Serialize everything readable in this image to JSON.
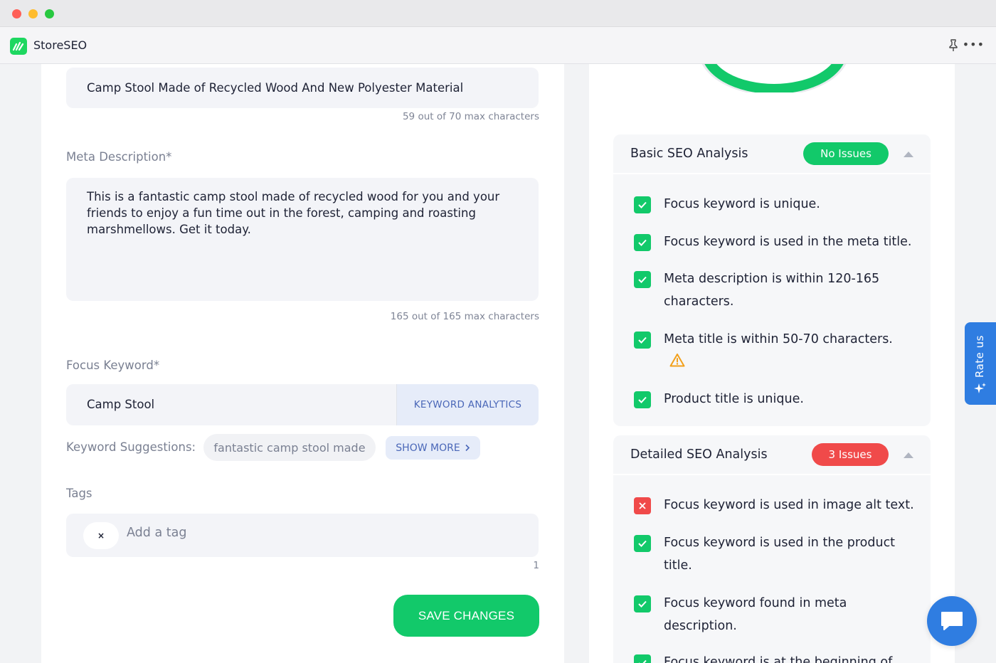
{
  "app": {
    "title": "StoreSEO",
    "accent": "#12c96a",
    "brand_blue": "#2f7de1"
  },
  "meta_title": {
    "value": "Camp Stool Made of Recycled Wood And New Polyester Material",
    "counter": "59 out of 70 max characters"
  },
  "meta_description": {
    "label": "Meta Description*",
    "value": "This is a fantastic camp stool made of recycled wood for you and your friends to enjoy a fun time out in the forest, camping and roasting marshmellows. Get it today.",
    "counter": "165 out of 165 max characters"
  },
  "focus_keyword": {
    "label": "Focus Keyword*",
    "value": "Camp Stool",
    "analytics_label": "KEYWORD ANALYTICS"
  },
  "suggestions": {
    "label": "Keyword Suggestions:",
    "chip": "fantastic camp stool made",
    "show_more": "SHOW MORE"
  },
  "tags": {
    "label": "Tags",
    "placeholder": "Add a tag",
    "remove_glyph": "×",
    "count": "1"
  },
  "save_label": "SAVE CHANGES",
  "basic": {
    "title": "Basic SEO Analysis",
    "badge": "No Issues",
    "items": [
      {
        "text": "Focus keyword is unique.",
        "status": "pass"
      },
      {
        "text": "Focus keyword is used in the meta title.",
        "status": "pass"
      },
      {
        "text": "Meta description is within 120-165 characters.",
        "status": "pass"
      },
      {
        "text": "Meta title is within 50-70 characters.",
        "status": "pass",
        "warning": "warning-icon"
      },
      {
        "text": "Product title is unique.",
        "status": "pass"
      }
    ]
  },
  "detailed": {
    "title": "Detailed SEO Analysis",
    "badge": "3 Issues",
    "items": [
      {
        "text": "Focus keyword is used in image alt text.",
        "status": "fail"
      },
      {
        "text": "Focus keyword is used in the product title.",
        "status": "pass"
      },
      {
        "text": "Focus keyword found in meta description.",
        "status": "pass"
      },
      {
        "text": "Focus keyword is at the beginning of",
        "status": "pass"
      }
    ]
  },
  "rate_us": "Rate us"
}
